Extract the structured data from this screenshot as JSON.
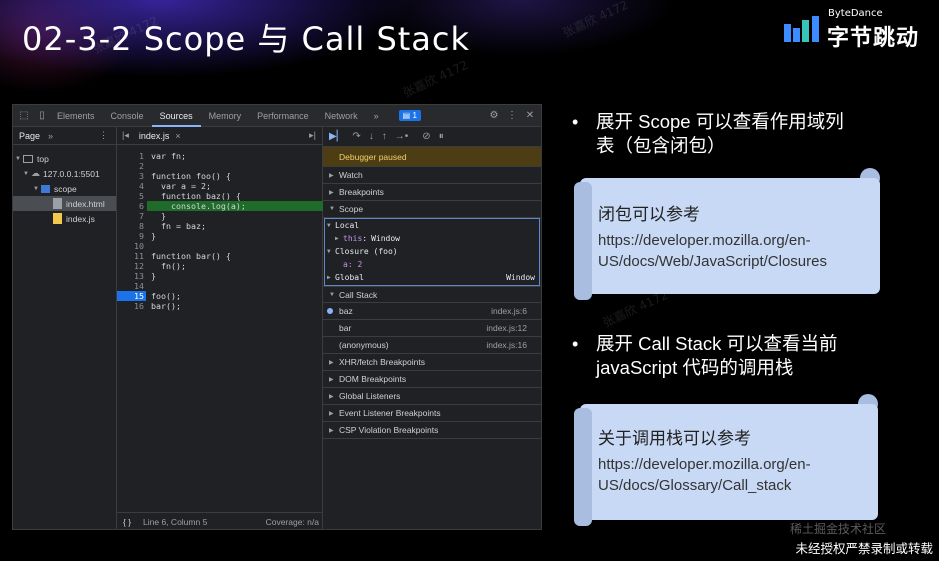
{
  "slide": {
    "title": "02-3-2 Scope 与 Call Stack",
    "logo_small": "ByteDance",
    "logo_big": "字节跳动",
    "footer_note": "未经授权严禁录制或转载",
    "watermarks": [
      "张嘉欣 4172",
      "稀土掘金技术社区"
    ]
  },
  "devtools": {
    "tabs": [
      "Elements",
      "Console",
      "Sources",
      "Memory",
      "Performance",
      "Network"
    ],
    "active_tab": "Sources",
    "more_tabs": "»",
    "badge": "1",
    "navigator": {
      "head": "Page",
      "more": "»",
      "tree": [
        {
          "label": "top",
          "indent": 0
        },
        {
          "label": "127.0.0.1:5501",
          "indent": 1
        },
        {
          "label": "scope",
          "indent": 2
        },
        {
          "label": "index.html",
          "indent": 3,
          "selected": true
        },
        {
          "label": "index.js",
          "indent": 3
        }
      ]
    },
    "editor": {
      "file_tab": "index.js",
      "close": "×",
      "lines": [
        "var fn;",
        "",
        "function foo() {",
        "  var a = 2;",
        "  function baz() {",
        "    console.log(a);",
        "  }",
        "  fn = baz;",
        "}",
        "",
        "function bar() {",
        "  fn();",
        "}",
        "",
        "foo();",
        "bar();"
      ],
      "highlight_line": 6,
      "breakpoint_line": 15,
      "status_braces": "{ }",
      "status_position": "Line 6, Column 5",
      "status_coverage": "Coverage: n/a"
    },
    "debugger": {
      "paused_label": "Debugger paused",
      "sections_top": [
        "Watch",
        "Breakpoints"
      ],
      "scope_label": "Scope",
      "scope": {
        "local_label": "Local",
        "this_key": "this",
        "this_value": "Window",
        "closure_label": "Closure (foo)",
        "closure_var": "a: 2",
        "global_label": "Global",
        "global_value": "Window"
      },
      "call_stack_label": "Call Stack",
      "call_stack": [
        {
          "fn": "baz",
          "loc": "index.js:6",
          "current": true
        },
        {
          "fn": "bar",
          "loc": "index.js:12"
        },
        {
          "fn": "(anonymous)",
          "loc": "index.js:16"
        }
      ],
      "sections_bottom": [
        "XHR/fetch Breakpoints",
        "DOM Breakpoints",
        "Global Listeners",
        "Event Listener Breakpoints",
        "CSP Violation Breakpoints"
      ]
    }
  },
  "notes": {
    "bullet1_line1": "展开 Scope 可以查看作用域列",
    "bullet1_line2": "表（包含闭包）",
    "box1_title": "闭包可以参考",
    "box1_url_line1": "https://developer.mozilla.org/en-",
    "box1_url_line2": "US/docs/Web/JavaScript/Closures",
    "bullet2_line1": "展开 Call Stack 可以查看当前",
    "bullet2_line2": "javaScript 代码的调用栈",
    "box2_title": "关于调用栈可以参考",
    "box2_url_line1": "https://developer.mozilla.org/en-",
    "box2_url_line2": "US/docs/Glossary/Call_stack"
  }
}
